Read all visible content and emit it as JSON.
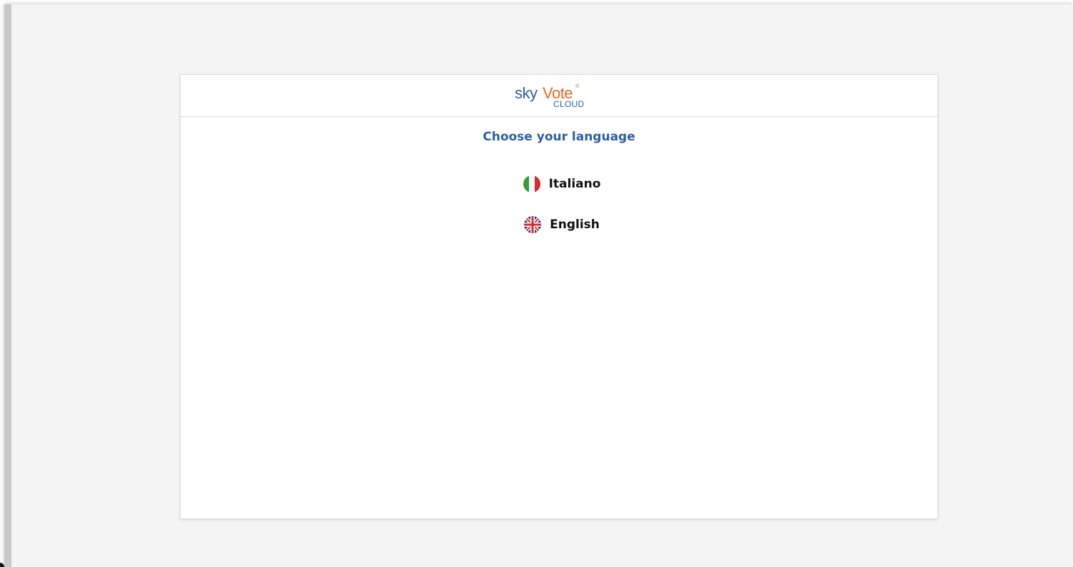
{
  "header": {
    "logo_icon": "skyvote-cloud-logo",
    "logo_sky": "sky",
    "logo_vote": "Vote",
    "logo_reg": "®",
    "logo_cloud": "CLOUD"
  },
  "title": "Choose your language",
  "languages": [
    {
      "label": "Italiano",
      "icon": "italy-flag-icon"
    },
    {
      "label": "English",
      "icon": "uk-flag-icon"
    }
  ],
  "colors": {
    "brand_blue": "#2d5fa3",
    "brand_orange": "#e8682a",
    "background": "#f4f4f4"
  }
}
